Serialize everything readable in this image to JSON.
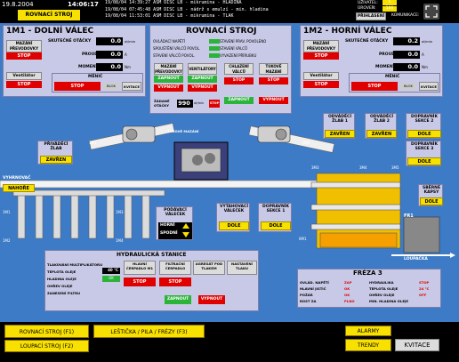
{
  "header": {
    "date": "19.8.2004",
    "time": "14:06:17",
    "title_label": "ROVNACÍ STROJ",
    "log_lines": [
      "19/08/04 14:39:27 ASM DISC LB - mikrumina - HLADINA",
      "19/08/04 07:45:48 ASM DISC LB - nádrž s emulzí - min. hladina",
      "19/08/04 11:53:01 ASM DISC LB - mikrumina - TLAK"
    ],
    "user_label": "UŽIVATEL:",
    "user_value": "s",
    "level_label": "ÚROVEŇ:",
    "level_value": "100",
    "login_button": "PŘIHLÁSENÍ",
    "comm_label": "KOMUNIKACE:",
    "fullscreen_icon": "expand-icon"
  },
  "left_panel": {
    "title": "1M1 - DOLNÍ VÁLEC",
    "drive_button": "MAZÁNÍ PŘEVODOVKY",
    "fan_button": "Ventilátor",
    "stop1": "STOP",
    "stop2": "STOP",
    "rows": [
      {
        "label": "SKUTEČNÉ OTÁČKY",
        "value": "0.0",
        "unit": "ot/min"
      },
      {
        "label": "PROUD",
        "value": "0.0",
        "unit": "A"
      },
      {
        "label": "MOMENT",
        "value": "0.0",
        "unit": "Nm"
      }
    ],
    "inverter_label": "MĚNIČ",
    "inverter_stop": "STOP",
    "inverter_block": "BLOK",
    "inverter_ack": "KVITACE"
  },
  "right_panel": {
    "title": "1M2 - HORNÍ VÁLEC",
    "drive_button": "MAZÁNÍ PŘEVODOVKY",
    "fan_button": "Ventilátor",
    "stop1": "STOP",
    "stop2": "STOP",
    "rows": [
      {
        "label": "SKUTEČNÉ OTÁČKY",
        "value": "0.2",
        "unit": "ot/min"
      },
      {
        "label": "PROUD",
        "value": "0.0",
        "unit": "A"
      },
      {
        "label": "MOMENT",
        "value": "0.0",
        "unit": "Nm"
      }
    ],
    "inverter_label": "MĚNIČ",
    "inverter_stop": "STOP",
    "inverter_block": "BLOK",
    "inverter_ack": "KVITACE"
  },
  "center_panel": {
    "title": "ROVNACÍ STROJ",
    "status_left": [
      "OVLÁDACÍ NAPĚTÍ",
      "SPOUŠTĚNÍ VÁLCŮ POVOL.",
      "STAVENÍ VÁLCŮ POVOL."
    ],
    "status_right": [
      "STAVENÍ PRAV. POVOLENO",
      "STAVENÍ VÁLCŮ",
      "VYVAZENÍ PŘÍRUBKU"
    ],
    "cols": [
      {
        "label": "MAZÁNÍ PŘEVODOVKY",
        "on": "ZAPNOUT",
        "off": "VYPNOUT"
      },
      {
        "label": "VENTILÁTORY",
        "on": "ZAPNOUT",
        "off": "VYPNOUT"
      },
      {
        "label": "CHLAZENÍ VÁLCŮ",
        "on": "STOP",
        "off": "ZAPNOUT"
      },
      {
        "label": "TUKOVÉ MAZÁNÍ",
        "on": "STOP",
        "off": "VYPNOUT"
      }
    ],
    "speed_label": "ŽÁDANÉ OTÁČKY",
    "speed_value": "990",
    "speed_unit": "ot/min",
    "stop_button": "STOP"
  },
  "process": {
    "tukove_mazani": "TUKOVÉ MAZÁNÍ",
    "privadeci_label": "PŘIVÁDĚCÍ ŽLAB",
    "privadeci_state": "ZAVŘEN",
    "vyhrnovac_label": "VYHRNOVAČ",
    "vyhrnovac_state": "NAHOŘE",
    "odvadeci1_label": "ODVÁDĚCÍ ŽLAB 1",
    "odvadeci1_state": "ZAVŘEN",
    "odvadeci2_label": "ODVÁDĚCÍ ŽLAB 2",
    "odvadeci2_state": "ZAVŘEN",
    "dopr2_label": "DOPRAVNÍK SEKCE 2",
    "dopr2_state": "DOLE",
    "dopr3_label": "DOPRAVNÍK SEKCE 3",
    "dopr3_state": "DOLE",
    "sberne_label": "SBĚRNÉ KAPSY",
    "sberne_state": "DOLE",
    "podavaci_label": "PODÁVACÍ VÁLEČEK",
    "horni": "HORNÍ",
    "spodni": "SPODNÍ",
    "vytahovaci_label": "VYTAHOVACÍ VÁLEČEK",
    "vytahovaci_state": "DOLE",
    "dopr1_label": "DOPRAVNÍK SEKCE 1",
    "dopr1_state": "DOLE",
    "loupacka": "LOUPAČKA",
    "fr1": "FR1",
    "tags": [
      "1M1",
      "1M2",
      "1M3",
      "1M4",
      "3M1",
      "3M2",
      "3M3",
      "3M4",
      "3M5",
      "6M1"
    ]
  },
  "hydraulics": {
    "title": "HYDRAULICKÁ STANICE",
    "lines": [
      "TLAKOVÁNÍ MULTIPLIKÁTORU",
      "TEPLOTA OLEJE",
      "HLADINA OLEJE",
      "OHŘEV OLEJE",
      "ZANESENÍ FILTRU"
    ],
    "values": [
      "",
      "40 °C",
      "OK",
      "",
      ""
    ],
    "cols": [
      "HLAVNÍ ČERPADLO M1",
      "FILTRAČNÍ ČERPADLO",
      "AGREGÁT POD TLAKEM",
      "NASTAVENÍ TLAKU"
    ],
    "stop": "STOP",
    "on": "ZAPNOUT",
    "off": "VYPNOUT"
  },
  "frezа": {
    "title": "FRÉZA 3",
    "left_rows": [
      {
        "label": "OVLÁD. NAPĚTÍ",
        "value": "ZAP"
      },
      {
        "label": "HLAVNÍ JISTIČ",
        "value": "OK"
      },
      {
        "label": "POŽÁR",
        "value": "OK"
      },
      {
        "label": "ROST ZA",
        "value": "PLNO"
      }
    ],
    "right_rows": [
      {
        "label": "HYDRAULIKA",
        "value": "STOP"
      },
      {
        "label": "TEPLOTA OLEJE",
        "value": "24 °C"
      },
      {
        "label": "OHŘEV OLEJE",
        "value": "OFF"
      },
      {
        "label": "MIN. HLADINA OLEJE",
        "value": ""
      }
    ]
  },
  "footer": {
    "btn1": "ROVNACÍ STROJ (F1)",
    "btn2": "LOUPACÍ STROJ (F2)",
    "btn3": "LEŠTIČKA / PILA / FRÉZY (F3)",
    "alarms": "ALARMY",
    "trends": "TRENDY",
    "ack": "KVITACE"
  }
}
